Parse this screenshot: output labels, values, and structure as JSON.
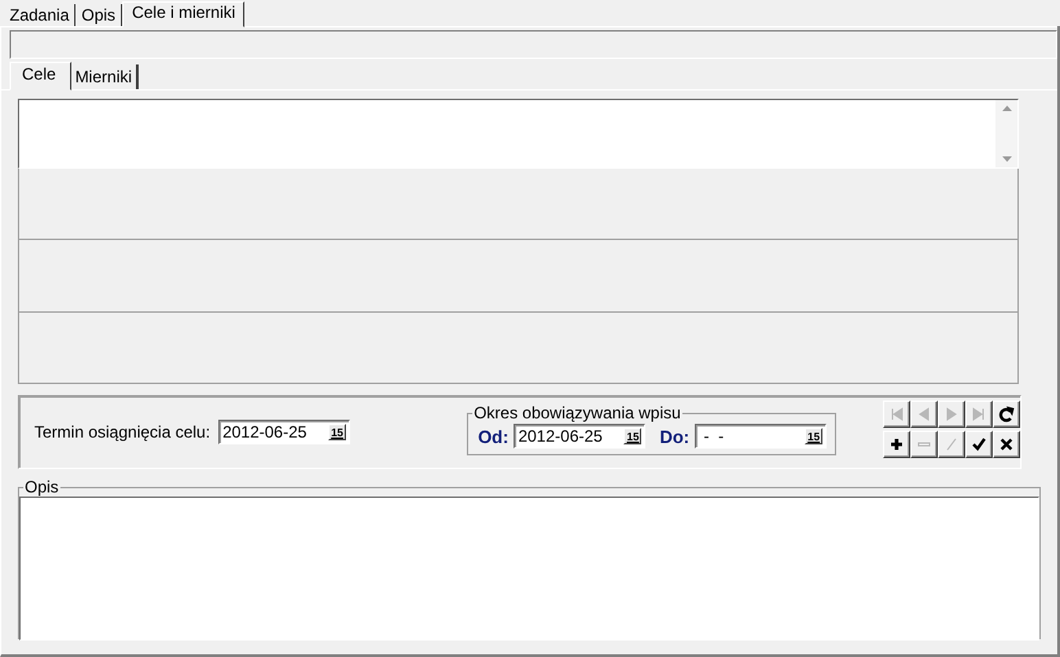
{
  "tabs": [
    {
      "label": "Zadania",
      "selected": false
    },
    {
      "label": "Opis",
      "selected": false
    },
    {
      "label": "Cele i mierniki",
      "selected": true
    }
  ],
  "subtabs": [
    {
      "label": "Cele",
      "selected": true
    },
    {
      "label": "Mierniki",
      "selected": false
    }
  ],
  "target_date": {
    "label": "Termin osiągnięcia celu:",
    "value": "2012-06-25",
    "button": "15"
  },
  "validity": {
    "title": "Okres obowiązywania wpisu",
    "from": {
      "label": "Od:",
      "value": "2012-06-25",
      "button": "15"
    },
    "to": {
      "label": "Do:",
      "value": " -  -",
      "button": "15"
    }
  },
  "navigator": [
    {
      "kind": "first",
      "disabled": true
    },
    {
      "kind": "prior",
      "disabled": true
    },
    {
      "kind": "next",
      "disabled": true
    },
    {
      "kind": "last",
      "disabled": true
    },
    {
      "kind": "refresh",
      "disabled": false
    },
    {
      "kind": "insert",
      "disabled": false
    },
    {
      "kind": "delete",
      "disabled": true
    },
    {
      "kind": "edit",
      "disabled": true
    },
    {
      "kind": "post",
      "disabled": false
    },
    {
      "kind": "cancel",
      "disabled": false
    }
  ],
  "description": {
    "title": "Opis"
  }
}
